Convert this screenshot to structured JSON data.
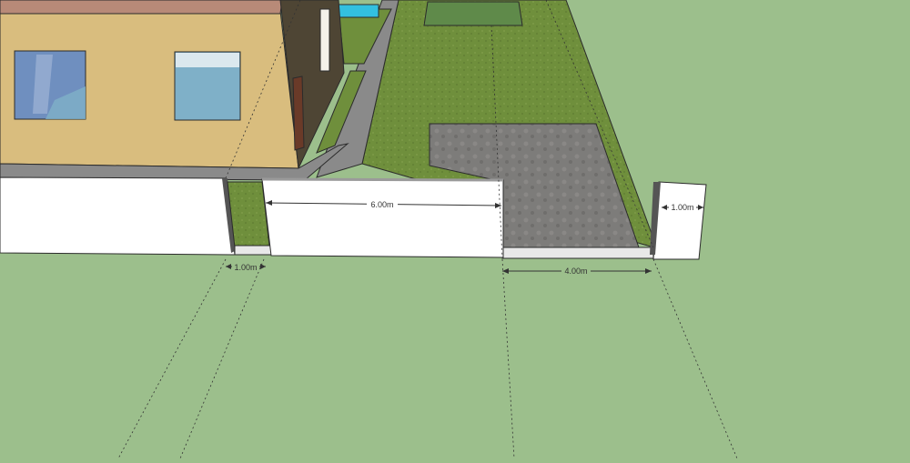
{
  "scene": {
    "dimensions": [
      {
        "id": "wall-length",
        "label": "6.00m"
      },
      {
        "id": "left-gap",
        "label": "1.00m"
      },
      {
        "id": "gate-opening",
        "label": "4.00m"
      },
      {
        "id": "pillar-width",
        "label": "1.00m"
      }
    ],
    "colors": {
      "sky_ground": "#9cbf8c",
      "lawn": "#6f8f3c",
      "paving": "#7d7c7a",
      "wall": "#ffffff",
      "house_wall": "#d9bd7e",
      "house_side": "#4e4534",
      "roof": "#b88a78",
      "pool": "#33c0e0",
      "window_glass": "#7fb0c8"
    }
  }
}
